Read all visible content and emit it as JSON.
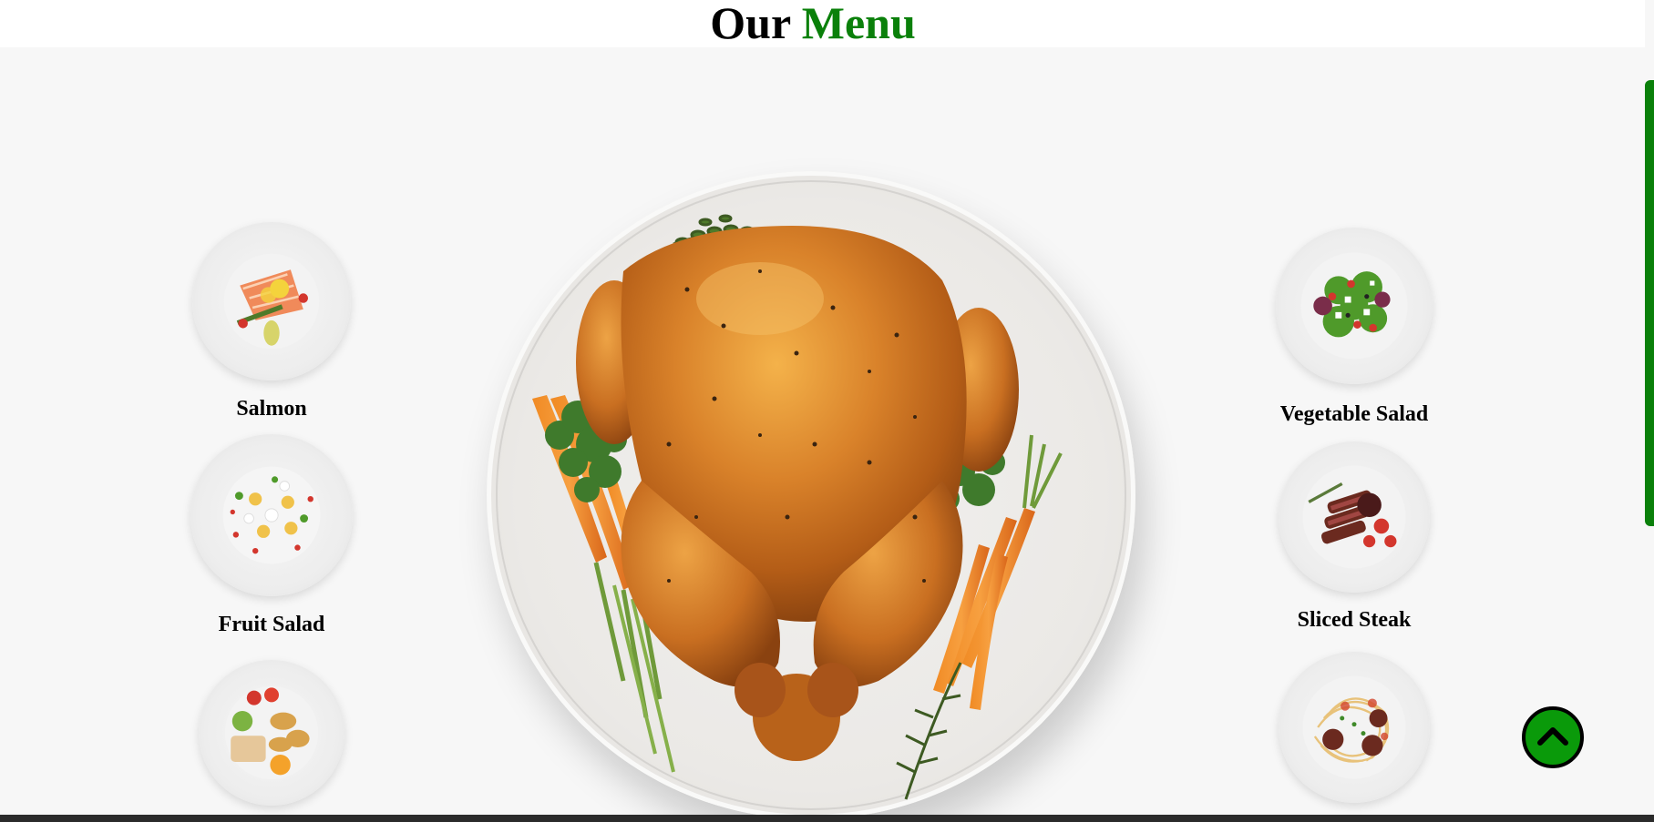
{
  "header": {
    "title_word_1": "Our",
    "title_word_2": "Menu"
  },
  "colors": {
    "accent": "#0a800a",
    "back_to_top_fill": "#0a9a0a",
    "background": "#f7f7f7"
  },
  "hero": {
    "dish": "roasted-chicken-image"
  },
  "menu": {
    "left": [
      {
        "name": "Salmon",
        "image": "salmon-image"
      },
      {
        "name": "Fruit Salad",
        "image": "fruit-salad-image"
      },
      {
        "name": "",
        "image": "potatoes-fish-image"
      }
    ],
    "right": [
      {
        "name": "Vegetable Salad",
        "image": "vegetable-salad-image"
      },
      {
        "name": "Sliced Steak",
        "image": "sliced-steak-image"
      },
      {
        "name": "",
        "image": "spaghetti-meatballs-image"
      }
    ]
  },
  "controls": {
    "back_to_top_icon": "chevron-up-icon"
  }
}
